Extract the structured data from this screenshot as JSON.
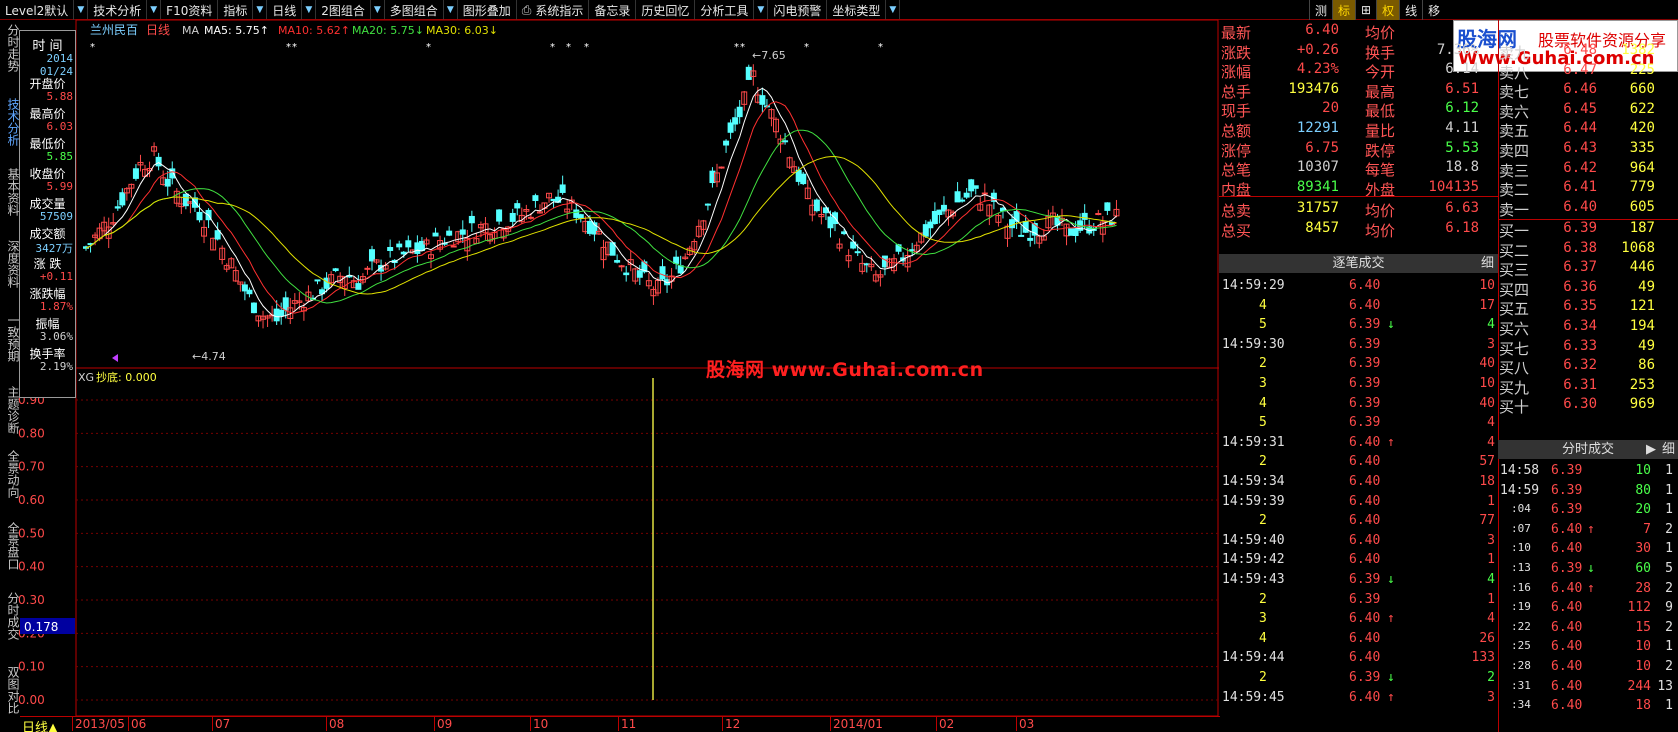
{
  "toolbar": {
    "items": [
      "Level2默认",
      "技术分析",
      "F10资料",
      "指标",
      "日线",
      "2图组合",
      "多图组合",
      "图形叠加",
      "系统指示",
      "备忘录",
      "历史回忆",
      "分析工具",
      "闪电预警",
      "坐标类型"
    ],
    "right_items": [
      "测",
      "标",
      "⊞",
      "权",
      "线",
      "移"
    ]
  },
  "side_tabs": [
    "分时走势",
    "技术分析",
    "基本资料",
    "深度资料",
    "一致预期",
    "主题诊断",
    "全景动向",
    "全景盘口",
    "分时成交",
    "双图对比"
  ],
  "info_box": {
    "title": "时 间",
    "date": "2014",
    "date2": "01/24",
    "rows": [
      {
        "label": "开盘价",
        "value": "5.88",
        "color": "#ff4a4a"
      },
      {
        "label": "最高价",
        "value": "6.03",
        "color": "#ff4a4a"
      },
      {
        "label": "最低价",
        "value": "5.85",
        "color": "#4aff4a"
      },
      {
        "label": "收盘价",
        "value": "5.99",
        "color": "#ff4a4a"
      },
      {
        "label": "成交量",
        "value": "57509",
        "color": "#7ccfff"
      },
      {
        "label": "成交额",
        "value": "3427万",
        "color": "#7ccfff"
      },
      {
        "label": "涨 跌",
        "value": "+0.11",
        "color": "#ff4a4a"
      },
      {
        "label": "涨跌幅",
        "value": "1.87%",
        "color": "#ff4a4a"
      },
      {
        "label": "振幅",
        "value": "3.06%",
        "color": "#d0d0d0"
      },
      {
        "label": "换手率",
        "value": "2.19%",
        "color": "#d0d0d0"
      }
    ]
  },
  "main_chart": {
    "stock": "兰州民百",
    "period": "日线",
    "ma_label": "MA",
    "ma": [
      {
        "name": "MA5",
        "value": "5.75↑",
        "color": "#ffffff"
      },
      {
        "name": "MA10",
        "value": "5.62↑",
        "color": "#ff3030"
      },
      {
        "name": "MA20",
        "value": "5.75↓",
        "color": "#40e040"
      },
      {
        "name": "MA30",
        "value": "6.03↓",
        "color": "#e0e000"
      }
    ],
    "high_mark": "7.65",
    "low_mark": "4.74"
  },
  "chart_data": [
    {
      "type": "candlestick",
      "title": "兰州民百 日线",
      "y_range": [
        4.5,
        7.9
      ],
      "x_labels": [
        "2013/05",
        "06",
        "07",
        "08",
        "09",
        "10",
        "11",
        "12",
        "2014/01",
        "02",
        "03"
      ],
      "close_series": [
        5.6,
        5.8,
        6.0,
        6.3,
        6.6,
        6.7,
        6.4,
        6.2,
        6.1,
        5.9,
        5.6,
        5.3,
        5.0,
        4.8,
        4.74,
        4.9,
        5.0,
        5.1,
        5.2,
        5.3,
        5.2,
        5.35,
        5.45,
        5.5,
        5.55,
        5.6,
        5.7,
        5.75,
        5.8,
        5.85,
        5.9,
        5.95,
        6.0,
        6.1,
        6.2,
        6.15,
        6.05,
        5.9,
        5.7,
        5.5,
        5.35,
        5.2,
        5.1,
        5.25,
        5.5,
        5.9,
        6.3,
        6.8,
        7.2,
        7.65,
        7.3,
        7.0,
        6.6,
        6.2,
        6.0,
        5.85,
        5.6,
        5.4,
        5.25,
        5.35,
        5.5,
        5.7,
        5.85,
        6.0,
        6.15,
        6.25,
        6.2,
        6.0,
        5.85,
        5.8,
        5.85,
        5.9,
        5.8,
        5.85,
        5.9,
        5.95,
        6.0
      ],
      "indicator": {
        "name": "XG",
        "label": "抄底",
        "value": "0.000",
        "y_ticks": [
          "0.90",
          "0.80",
          "0.70",
          "0.60",
          "0.50",
          "0.40",
          "0.30",
          "0.20",
          "0.10",
          "0.00"
        ],
        "cursor_value": "0.178"
      }
    }
  ],
  "watermark": "股海网 www.Guhai.com.cn",
  "logo": {
    "top": "股海网",
    "top_right": "股票软件资源分享",
    "url": "Www.Guhai.com.cn"
  },
  "bottom_tab": "日线▲",
  "quote": {
    "left": [
      {
        "label": "最新",
        "value": "6.40",
        "color": "#ff4a4a"
      },
      {
        "label": "涨跌",
        "value": "+0.26",
        "color": "#ff4a4a"
      },
      {
        "label": "涨幅",
        "value": "4.23%",
        "color": "#ff4a4a"
      },
      {
        "label": "总手",
        "value": "193476",
        "color": "#ffff40"
      },
      {
        "label": "现手",
        "value": "20",
        "color": "#ff4a4a"
      },
      {
        "label": "总额",
        "value": "12291",
        "color": "#7ccfff"
      },
      {
        "label": "涨停",
        "value": "6.75",
        "color": "#ff4a4a"
      },
      {
        "label": "总笔",
        "value": "10307",
        "color": "#d0d0d0"
      },
      {
        "label": "内盘",
        "value": "89341",
        "color": "#4aff4a"
      },
      {
        "label": "总卖",
        "value": "31757",
        "color": "#ffff40"
      },
      {
        "label": "总买",
        "value": "8457",
        "color": "#ffff40"
      }
    ],
    "right": [
      {
        "label": "均价",
        "value": "",
        "color": "#ff4a4a"
      },
      {
        "label": "换手",
        "value": "7.36%",
        "color": "#d0d0d0"
      },
      {
        "label": "今开",
        "value": "6.14",
        "color": "#d0d0d0"
      },
      {
        "label": "最高",
        "value": "6.51",
        "color": "#ff4a4a"
      },
      {
        "label": "最低",
        "value": "6.12",
        "color": "#4aff4a"
      },
      {
        "label": "量比",
        "value": "4.11",
        "color": "#d0d0d0"
      },
      {
        "label": "跌停",
        "value": "5.53",
        "color": "#4aff4a"
      },
      {
        "label": "每笔",
        "value": "18.8",
        "color": "#d0d0d0"
      },
      {
        "label": "外盘",
        "value": "104135",
        "color": "#ff4a4a"
      },
      {
        "label": "均价",
        "value": "6.63",
        "color": "#ff4a4a"
      },
      {
        "label": "均价",
        "value": "6.18",
        "color": "#ff4a4a"
      }
    ]
  },
  "order_book": {
    "sell": [
      {
        "label": "卖九",
        "price": "6.48",
        "vol": "1382"
      },
      {
        "label": "卖八",
        "price": "6.47",
        "vol": "225"
      },
      {
        "label": "卖七",
        "price": "6.46",
        "vol": "660"
      },
      {
        "label": "卖六",
        "price": "6.45",
        "vol": "622"
      },
      {
        "label": "卖五",
        "price": "6.44",
        "vol": "420"
      },
      {
        "label": "卖四",
        "price": "6.43",
        "vol": "335"
      },
      {
        "label": "卖三",
        "price": "6.42",
        "vol": "964"
      },
      {
        "label": "卖二",
        "price": "6.41",
        "vol": "779"
      },
      {
        "label": "卖一",
        "price": "6.40",
        "vol": "605"
      }
    ],
    "buy": [
      {
        "label": "买一",
        "price": "6.39",
        "vol": "187"
      },
      {
        "label": "买二",
        "price": "6.38",
        "vol": "1068"
      },
      {
        "label": "买三",
        "price": "6.37",
        "vol": "446"
      },
      {
        "label": "买四",
        "price": "6.36",
        "vol": "49"
      },
      {
        "label": "买五",
        "price": "6.35",
        "vol": "121"
      },
      {
        "label": "买六",
        "price": "6.34",
        "vol": "194"
      },
      {
        "label": "买七",
        "price": "6.33",
        "vol": "49"
      },
      {
        "label": "买八",
        "price": "6.32",
        "vol": "86"
      },
      {
        "label": "买九",
        "price": "6.31",
        "vol": "253"
      },
      {
        "label": "买十",
        "price": "6.30",
        "vol": "969"
      }
    ]
  },
  "tick_panel": {
    "title": "逐笔成交",
    "detail": "细",
    "rows": [
      {
        "t": "14:59:29",
        "p": "6.40",
        "d": "",
        "v": "10"
      },
      {
        "t": "4",
        "p": "6.40",
        "d": "",
        "v": "17"
      },
      {
        "t": "5",
        "p": "6.39",
        "d": "↓",
        "v": "4"
      },
      {
        "t": "14:59:30",
        "p": "6.39",
        "d": "",
        "v": "3"
      },
      {
        "t": "2",
        "p": "6.39",
        "d": "",
        "v": "40"
      },
      {
        "t": "3",
        "p": "6.39",
        "d": "",
        "v": "10"
      },
      {
        "t": "4",
        "p": "6.39",
        "d": "",
        "v": "40"
      },
      {
        "t": "5",
        "p": "6.39",
        "d": "",
        "v": "4"
      },
      {
        "t": "14:59:31",
        "p": "6.40",
        "d": "↑",
        "v": "4"
      },
      {
        "t": "2",
        "p": "6.40",
        "d": "",
        "v": "57"
      },
      {
        "t": "14:59:34",
        "p": "6.40",
        "d": "",
        "v": "18"
      },
      {
        "t": "14:59:39",
        "p": "6.40",
        "d": "",
        "v": "1"
      },
      {
        "t": "2",
        "p": "6.40",
        "d": "",
        "v": "77"
      },
      {
        "t": "14:59:40",
        "p": "6.40",
        "d": "",
        "v": "3"
      },
      {
        "t": "14:59:42",
        "p": "6.40",
        "d": "",
        "v": "1"
      },
      {
        "t": "14:59:43",
        "p": "6.39",
        "d": "↓",
        "v": "4"
      },
      {
        "t": "2",
        "p": "6.39",
        "d": "",
        "v": "1"
      },
      {
        "t": "3",
        "p": "6.40",
        "d": "↑",
        "v": "4"
      },
      {
        "t": "4",
        "p": "6.40",
        "d": "",
        "v": "26"
      },
      {
        "t": "14:59:44",
        "p": "6.40",
        "d": "",
        "v": "133"
      },
      {
        "t": "2",
        "p": "6.39",
        "d": "↓",
        "v": "2"
      },
      {
        "t": "14:59:45",
        "p": "6.40",
        "d": "↑",
        "v": "3"
      }
    ]
  },
  "minute_panel": {
    "title": "分时成交",
    "detail": "细",
    "rows": [
      {
        "t": "14:58",
        "p": "6.39",
        "d": "",
        "v": "10",
        "n": "1"
      },
      {
        "t": "14:59",
        "p": "6.39",
        "d": "",
        "v": "80",
        "n": "1"
      },
      {
        "t": ":04",
        "p": "6.39",
        "d": "",
        "v": "20",
        "n": "1"
      },
      {
        "t": ":07",
        "p": "6.40",
        "d": "↑",
        "v": "7",
        "n": "2"
      },
      {
        "t": ":10",
        "p": "6.40",
        "d": "",
        "v": "30",
        "n": "1"
      },
      {
        "t": ":13",
        "p": "6.39",
        "d": "↓",
        "v": "60",
        "n": "5"
      },
      {
        "t": ":16",
        "p": "6.40",
        "d": "↑",
        "v": "28",
        "n": "2"
      },
      {
        "t": ":19",
        "p": "6.40",
        "d": "",
        "v": "112",
        "n": "9"
      },
      {
        "t": ":22",
        "p": "6.40",
        "d": "",
        "v": "15",
        "n": "2"
      },
      {
        "t": ":25",
        "p": "6.40",
        "d": "",
        "v": "10",
        "n": "1"
      },
      {
        "t": ":28",
        "p": "6.40",
        "d": "",
        "v": "10",
        "n": "2"
      },
      {
        "t": ":31",
        "p": "6.40",
        "d": "",
        "v": "244",
        "n": "13"
      },
      {
        "t": ":34",
        "p": "6.40",
        "d": "",
        "v": "18",
        "n": "1"
      }
    ]
  }
}
